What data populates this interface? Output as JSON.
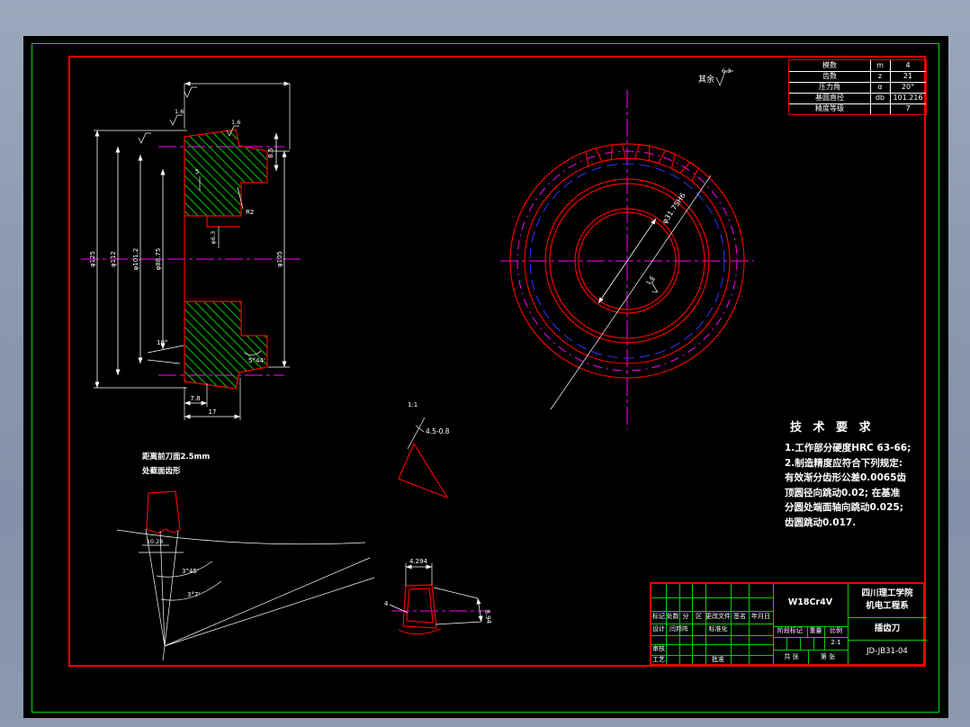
{
  "window": {
    "desktop_bg": "#8d9bb1",
    "canvas_bg": "#000000",
    "border_green": "#00dc00",
    "frame_red": "#f00000"
  },
  "param_table": {
    "rows": [
      {
        "label": "模数",
        "sym": "m",
        "val": "4"
      },
      {
        "label": "齿数",
        "sym": "z",
        "val": "21"
      },
      {
        "label": "压力角",
        "sym": "α",
        "val": "20°"
      },
      {
        "label": "基圆直径",
        "sym": "db",
        "val": "101.216"
      },
      {
        "label": "精度等级",
        "sym": "",
        "val": "7"
      }
    ]
  },
  "tech_req": {
    "title": "技 术 要 求",
    "lines": [
      "1.工作部分硬度HRC 63-66;",
      "2.制造精度应符合下列规定:",
      "有效渐分齿形公差0.0065齿",
      "顶圆径向跳动0.02; 在基准",
      "分圆处端面轴向跳动0.025;",
      "齿圆跳动0.017."
    ]
  },
  "surface_note": {
    "prefix": "其余",
    "value": "6.3"
  },
  "title_block": {
    "school_line1": "四川理工学院",
    "school_line2": "机电工程系",
    "part_name": "插齿刀",
    "drawing_no": "JD-JB31-04",
    "material": "W18Cr4V",
    "labels": {
      "mark": "标记",
      "count": "处数",
      "zone1": "分",
      "zone2": "区",
      "doc": "更改文件",
      "sign": "签名",
      "date": "年月日",
      "design": "设计",
      "designer": "闫邦阵",
      "std": "标准化",
      "audit": "审核",
      "craft": "工艺",
      "approve": "批准",
      "stage": "阶段标记",
      "weight": "重量",
      "scale": "比例",
      "scale_val": "2:1",
      "total": "共  张",
      "num": "第  张"
    }
  },
  "section_view": {
    "dims": {
      "d1": "φ125",
      "d2": "φ112",
      "d3": "φ101.2",
      "d4": "φ88.75",
      "d5": "φ105",
      "w1": "7.8",
      "w2": "17",
      "step": "5",
      "r": "R2",
      "hole": "φ6.3",
      "a1": "10°",
      "a2": "5°44'",
      "t1": "8.5",
      "r1": "1.6",
      "r2": "1.6"
    }
  },
  "front_view": {
    "bore": "φ31.75H6",
    "rough": "1.6"
  },
  "detail_a": {
    "note1": "距离前刀面2.5mm",
    "note2": "处截面齿形",
    "dim": "10.28",
    "angle1": "3°45'",
    "angle2": "3°7'"
  },
  "detail_b": {
    "scale": "1:1",
    "dim": "4.5-0.8"
  },
  "detail_c": {
    "top": "4.294",
    "right": "8.94",
    "left": "4"
  }
}
